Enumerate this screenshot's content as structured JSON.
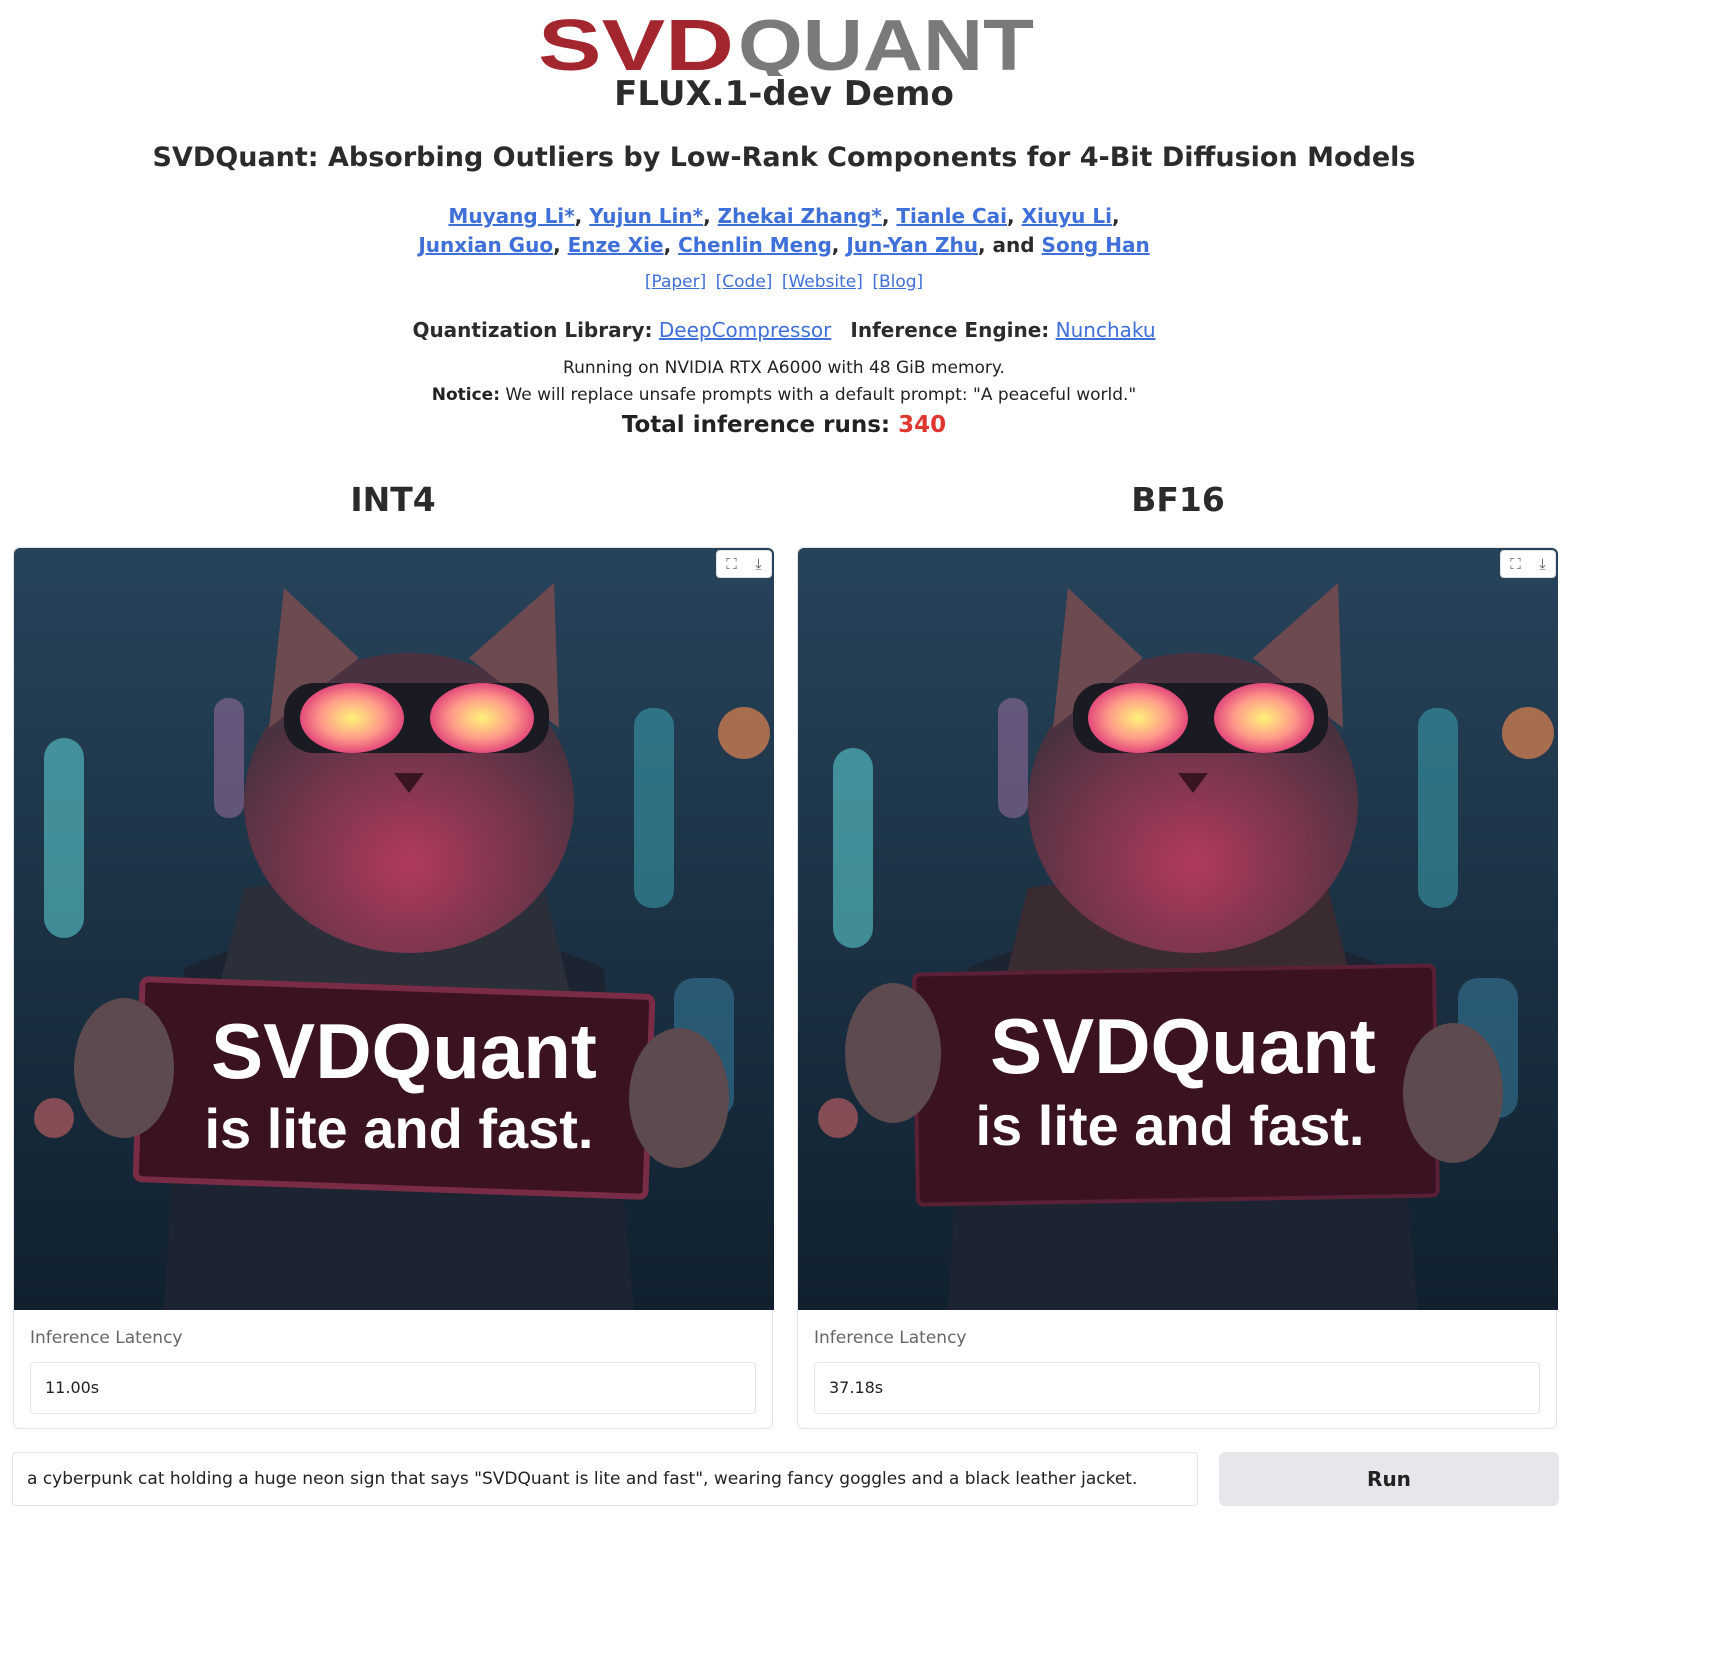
{
  "logo": {
    "text_left": "SVD",
    "text_right": "QUANT",
    "colors": {
      "left": "#a3262e",
      "right": "#7a7a7d"
    }
  },
  "demo_title": "FLUX.1-dev Demo",
  "paper_title": "SVDQuant: Absorbing Outliers by Low-Rank Components for 4-Bit Diffusion Models",
  "authors": {
    "list": [
      "Muyang Li*",
      "Yujun Lin*",
      "Zhekai Zhang*",
      "Tianle Cai",
      "Xiuyu Li",
      "Junxian Guo",
      "Enze Xie",
      "Chenlin Meng",
      "Jun-Yan Zhu",
      "Song Han"
    ],
    "and_word": "and"
  },
  "links": [
    "[Paper]",
    "[Code]",
    "[Website]",
    "[Blog]"
  ],
  "library": {
    "label": "Quantization Library:",
    "value": "DeepCompressor"
  },
  "engine": {
    "label": "Inference Engine:",
    "value": "Nunchaku"
  },
  "running": "Running on NVIDIA RTX A6000 with 48 GiB memory.",
  "notice": {
    "label": "Notice:",
    "text": "We will replace unsafe prompts with a default prompt: \"A peaceful world.\""
  },
  "runs": {
    "label": "Total inference runs:",
    "count": "340"
  },
  "panels": [
    {
      "title": "INT4",
      "sign_line1": "SVDQuant",
      "sign_line2": "is lite and fast.",
      "latency_label": "Inference Latency",
      "latency": "11.00s"
    },
    {
      "title": "BF16",
      "sign_line1": "SVDQuant",
      "sign_line2": "is lite and fast.",
      "latency_label": "Inference Latency",
      "latency": "37.18s"
    }
  ],
  "icons": {
    "fullscreen": "fullscreen-icon",
    "download": "download-icon"
  },
  "prompt": "a cyberpunk cat holding a huge neon sign that says \"SVDQuant is lite and fast\", wearing fancy goggles and a black leather jacket.",
  "run_label": "Run",
  "accent": "#e0362f",
  "link_color": "#3f6fd8"
}
